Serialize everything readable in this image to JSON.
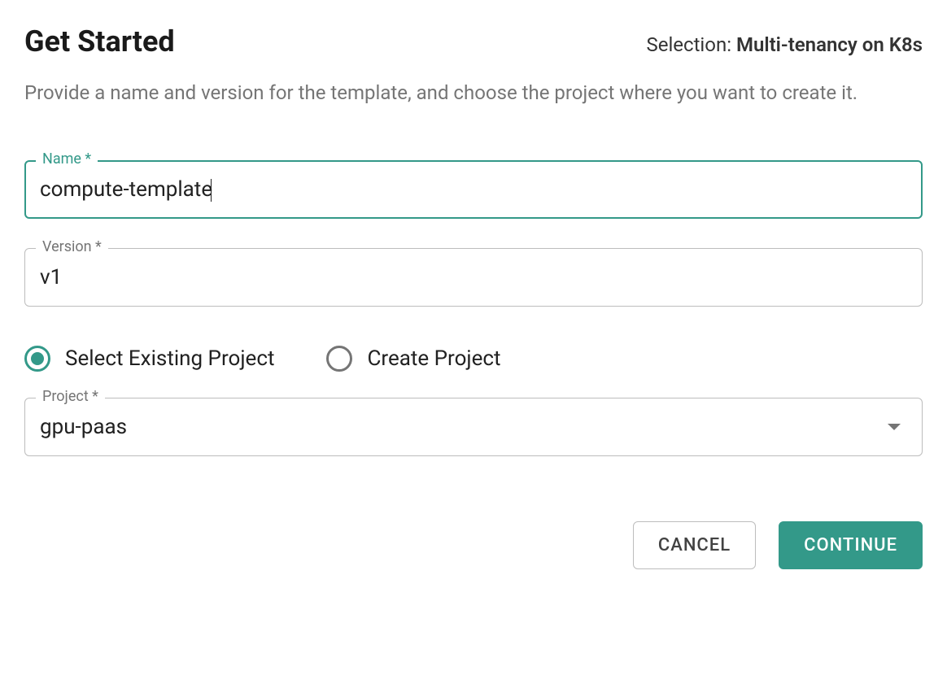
{
  "header": {
    "title": "Get Started",
    "selection_label": "Selection: ",
    "selection_value": "Multi-tenancy on K8s"
  },
  "description": "Provide a name and version for the template, and choose the project where you want to create it.",
  "fields": {
    "name": {
      "label": "Name *",
      "value": "compute-template"
    },
    "version": {
      "label": "Version *",
      "value": "v1"
    },
    "project": {
      "label": "Project *",
      "value": "gpu-paas"
    }
  },
  "radios": {
    "existing": "Select Existing Project",
    "create": "Create Project"
  },
  "actions": {
    "cancel": "CANCEL",
    "continue": "CONTINUE"
  }
}
